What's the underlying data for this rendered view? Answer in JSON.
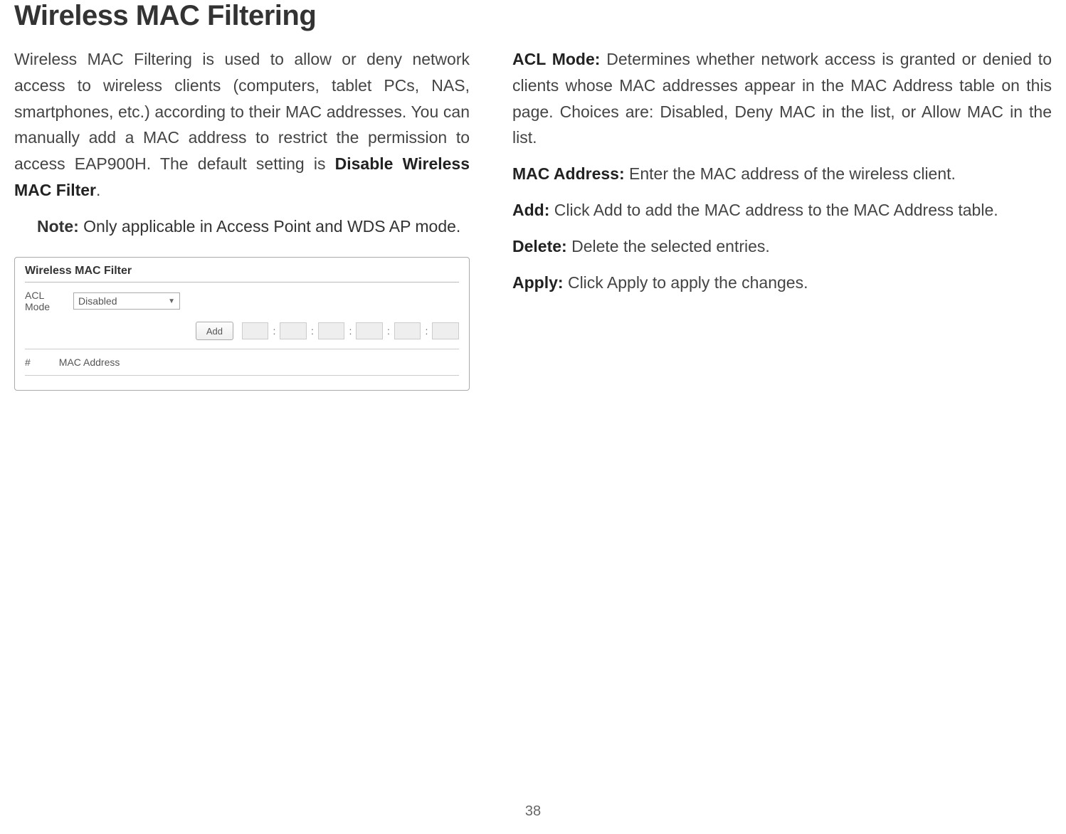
{
  "title": "Wireless MAC Filtering",
  "left": {
    "intro_1": "Wireless MAC Filtering is used to allow or deny network access to wireless clients (computers, tablet PCs, NAS, smartphones, etc.) according to their MAC addresses. You can manually add a MAC address to restrict the permission to access EAP900H. The default setting is ",
    "intro_bold": "Disable Wireless MAC Filter",
    "intro_end": ".",
    "note_label": "Note:",
    "note_text": "  Only applicable in Access Point and WDS AP mode."
  },
  "screenshot": {
    "panel_title": "Wireless MAC Filter",
    "acl_label": "ACL Mode",
    "acl_value": "Disabled",
    "add_label": "Add",
    "hash": "#",
    "mac_col": "MAC Address"
  },
  "right": {
    "acl_term": "ACL Mode:",
    "acl_text": " Determines whether network access is granted or denied to clients whose MAC addresses appear in the MAC Address table on this page. Choices are: Disabled, Deny MAC in the list, or Allow MAC in the list.",
    "mac_term": "MAC Address:",
    "mac_text": " Enter the MAC address of the wireless client.",
    "add_term": "Add:",
    "add_text": " Click Add to add the MAC address to the MAC Address table.",
    "del_term": "Delete:",
    "del_text": " Delete the selected entries.",
    "apply_term": "Apply:",
    "apply_text": " Click Apply to apply the changes."
  },
  "page_number": "38"
}
